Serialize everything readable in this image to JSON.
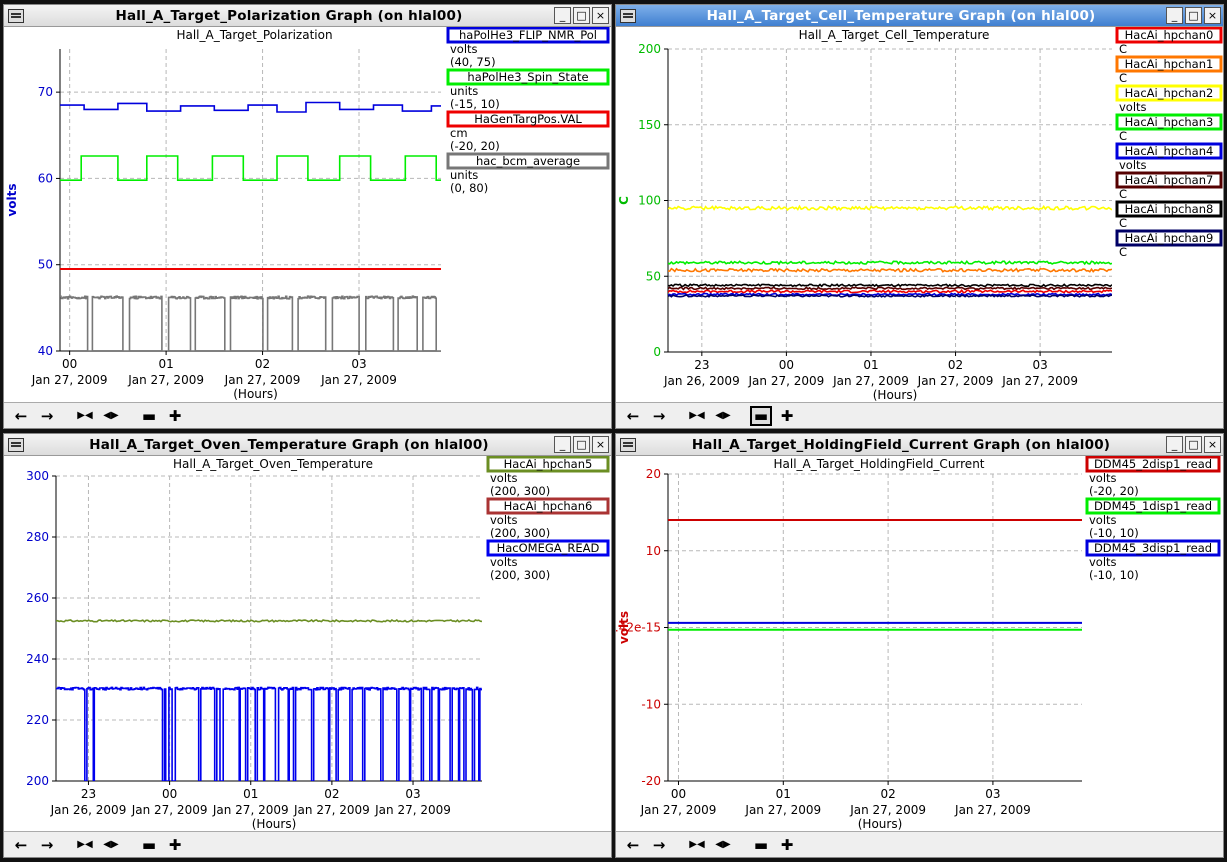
{
  "windows": [
    {
      "title": "Hall_A_Target_Polarization Graph (on hlal00)",
      "active": false,
      "chart_data": {
        "type": "line",
        "title": "Hall_A_Target_Polarization",
        "ylabel": "volts",
        "ylabel_color": "#0000cc",
        "xlabel": "(Hours)",
        "ylim": [
          40,
          75
        ],
        "xlim": [
          -0.1,
          3.85
        ],
        "yticks": [
          40,
          50,
          60,
          70
        ],
        "ytick_color": "#0000cc",
        "xticks": [
          {
            "x": 0,
            "label": "00",
            "date": "Jan 27, 2009"
          },
          {
            "x": 1,
            "label": "01",
            "date": "Jan 27, 2009"
          },
          {
            "x": 2,
            "label": "02",
            "date": "Jan 27, 2009"
          },
          {
            "x": 3,
            "label": "03",
            "date": "Jan 27, 2009"
          }
        ],
        "series": [
          {
            "name": "haPolHe3_FLIP_NMR_Pol",
            "color": "#0000dd",
            "unit": "volts",
            "range": "(40, 75)",
            "kind": "step",
            "points": [
              [
                -0.1,
                68.5
              ],
              [
                0.15,
                68.5
              ],
              [
                0.15,
                68.0
              ],
              [
                0.5,
                68.0
              ],
              [
                0.5,
                68.7
              ],
              [
                0.8,
                68.7
              ],
              [
                0.8,
                67.8
              ],
              [
                1.15,
                67.8
              ],
              [
                1.15,
                68.4
              ],
              [
                1.5,
                68.4
              ],
              [
                1.5,
                67.9
              ],
              [
                1.85,
                67.9
              ],
              [
                1.85,
                68.5
              ],
              [
                2.15,
                68.5
              ],
              [
                2.15,
                67.7
              ],
              [
                2.45,
                67.7
              ],
              [
                2.45,
                68.8
              ],
              [
                2.8,
                68.8
              ],
              [
                2.8,
                68.0
              ],
              [
                3.15,
                68.0
              ],
              [
                3.15,
                68.5
              ],
              [
                3.45,
                68.5
              ],
              [
                3.45,
                67.8
              ],
              [
                3.75,
                67.8
              ],
              [
                3.75,
                68.4
              ],
              [
                3.85,
                68.4
              ]
            ]
          },
          {
            "name": "haPolHe3_Spin_State",
            "color": "#00ee00",
            "unit": "units",
            "range": "(-15, 10)",
            "kind": "pulse",
            "base": 59.8,
            "high": 62.6,
            "pulses": [
              [
                0.12,
                0.5
              ],
              [
                0.8,
                1.12
              ],
              [
                1.48,
                1.8
              ],
              [
                2.15,
                2.47
              ],
              [
                2.8,
                3.12
              ],
              [
                3.48,
                3.8
              ]
            ]
          },
          {
            "name": "HaGenTargPos.VAL",
            "color": "#ee0000",
            "unit": "cm",
            "range": "(-20, 20)",
            "kind": "flat",
            "value": 49.5
          },
          {
            "name": "hac_bcm_average",
            "color": "#777777",
            "unit": "units",
            "range": "(0, 80)",
            "kind": "beam",
            "high": 46.2,
            "low": 40.0,
            "drops": [
              [
                0.18,
                0.23
              ],
              [
                0.55,
                0.62
              ],
              [
                0.95,
                1.02
              ],
              [
                1.25,
                1.3
              ],
              [
                1.6,
                1.66
              ],
              [
                2.0,
                2.05
              ],
              [
                2.3,
                2.36
              ],
              [
                2.65,
                2.72
              ],
              [
                3.0,
                3.06
              ],
              [
                3.35,
                3.4
              ],
              [
                3.6,
                3.66
              ],
              [
                3.8,
                3.85
              ]
            ]
          }
        ]
      }
    },
    {
      "title": "Hall_A_Target_Cell_Temperature Graph (on hlal00)",
      "active": true,
      "chart_data": {
        "type": "line",
        "title": "Hall_A_Target_Cell_Temperature",
        "ylabel": "C",
        "ylabel_color": "#00bb00",
        "xlabel": "(Hours)",
        "ylim": [
          0,
          200
        ],
        "xlim": [
          -1.4,
          3.85
        ],
        "yticks": [
          0,
          50,
          100,
          150,
          200
        ],
        "ytick_color": "#00bb00",
        "xticks": [
          {
            "x": -1,
            "label": "23",
            "date": "Jan 26, 2009"
          },
          {
            "x": 0,
            "label": "00",
            "date": "Jan 27, 2009"
          },
          {
            "x": 1,
            "label": "01",
            "date": "Jan 27, 2009"
          },
          {
            "x": 2,
            "label": "02",
            "date": "Jan 27, 2009"
          },
          {
            "x": 3,
            "label": "03",
            "date": "Jan 27, 2009"
          }
        ],
        "series": [
          {
            "name": "HacAi_hpchan0",
            "color": "#ee0000",
            "unit": "C",
            "kind": "noisy",
            "value": 40,
            "amp": 0.8
          },
          {
            "name": "HacAi_hpchan1",
            "color": "#ff7700",
            "unit": "C",
            "kind": "noisy",
            "value": 54,
            "amp": 1.0
          },
          {
            "name": "HacAi_hpchan2",
            "color": "#ffff00",
            "unit": "volts",
            "kind": "noisy",
            "value": 95,
            "amp": 1.2
          },
          {
            "name": "HacAi_hpchan3",
            "color": "#00ee00",
            "unit": "C",
            "kind": "noisy",
            "value": 59,
            "amp": 0.9
          },
          {
            "name": "HacAi_hpchan4",
            "color": "#0000dd",
            "unit": "volts",
            "kind": "noisy",
            "value": 38,
            "amp": 0.6
          },
          {
            "name": "HacAi_hpchan7",
            "color": "#550000",
            "unit": "C",
            "kind": "noisy",
            "value": 42,
            "amp": 0.7
          },
          {
            "name": "HacAi_hpchan8",
            "color": "#000000",
            "unit": "C",
            "kind": "noisy",
            "value": 44,
            "amp": 0.7
          },
          {
            "name": "HacAi_hpchan9",
            "color": "#000066",
            "unit": "C",
            "kind": "noisy",
            "value": 37,
            "amp": 0.6
          }
        ]
      }
    },
    {
      "title": "Hall_A_Target_Oven_Temperature Graph (on hlal00)",
      "active": false,
      "chart_data": {
        "type": "line",
        "title": "Hall_A_Target_Oven_Temperature",
        "ylabel": "",
        "ylabel_color": "#0000cc",
        "xlabel": "(Hours)",
        "ylim": [
          200,
          300
        ],
        "xlim": [
          -1.4,
          3.85
        ],
        "yticks": [
          200,
          220,
          240,
          260,
          280,
          300
        ],
        "ytick_color": "#0000cc",
        "xticks": [
          {
            "x": -1,
            "label": "23",
            "date": "Jan 26, 2009"
          },
          {
            "x": 0,
            "label": "00",
            "date": "Jan 27, 2009"
          },
          {
            "x": 1,
            "label": "01",
            "date": "Jan 27, 2009"
          },
          {
            "x": 2,
            "label": "02",
            "date": "Jan 27, 2009"
          },
          {
            "x": 3,
            "label": "03",
            "date": "Jan 27, 2009"
          }
        ],
        "series": [
          {
            "name": "HacAi_hpchan5",
            "color": "#6b8e23",
            "unit": "volts",
            "range": "(200, 300)",
            "kind": "noisy",
            "value": 252.5,
            "amp": 0.3
          },
          {
            "name": "HacAi_hpchan6",
            "color": "#aa3333",
            "unit": "volts",
            "range": "(200, 300)",
            "kind": "none"
          },
          {
            "name": "HacOMEGA_READ",
            "color": "#0000ee",
            "unit": "volts",
            "range": "(200, 300)",
            "kind": "beam",
            "high": 230.3,
            "low": 200.0,
            "noise": 0.4,
            "drops": [
              [
                -1.05,
                -1.03
              ],
              [
                -0.95,
                -0.93
              ],
              [
                -0.1,
                -0.07
              ],
              [
                -0.05,
                -0.02
              ],
              [
                0.03,
                0.06
              ],
              [
                0.35,
                0.38
              ],
              [
                0.55,
                0.58
              ],
              [
                0.62,
                0.65
              ],
              [
                0.85,
                0.87
              ],
              [
                0.93,
                0.95
              ],
              [
                1.05,
                1.07
              ],
              [
                1.15,
                1.17
              ],
              [
                1.3,
                1.33
              ],
              [
                1.45,
                1.47
              ],
              [
                1.52,
                1.54
              ],
              [
                1.75,
                1.77
              ],
              [
                1.95,
                1.97
              ],
              [
                2.05,
                2.07
              ],
              [
                2.22,
                2.24
              ],
              [
                2.38,
                2.4
              ],
              [
                2.6,
                2.62
              ],
              [
                2.8,
                2.82
              ],
              [
                2.95,
                2.97
              ],
              [
                3.1,
                3.12
              ],
              [
                3.2,
                3.22
              ],
              [
                3.3,
                3.32
              ],
              [
                3.45,
                3.47
              ],
              [
                3.55,
                3.57
              ],
              [
                3.62,
                3.64
              ],
              [
                3.73,
                3.75
              ],
              [
                3.8,
                3.82
              ]
            ]
          }
        ]
      }
    },
    {
      "title": "Hall_A_Target_HoldingField_Current Graph (on hlal00)",
      "active": false,
      "chart_data": {
        "type": "line",
        "title": "Hall_A_Target_HoldingField_Current",
        "ylabel": "volts",
        "ylabel_color": "#cc0000",
        "xlabel": "(Hours)",
        "ylim": [
          -20,
          20
        ],
        "xlim": [
          -0.1,
          3.85
        ],
        "yticks": [
          -20,
          -10,
          0,
          10,
          20
        ],
        "ytick_labels": [
          "-20",
          "-10",
          "1.42e-15",
          "10",
          "20"
        ],
        "ytick_color": "#cc0000",
        "xticks": [
          {
            "x": 0,
            "label": "00",
            "date": "Jan 27, 2009"
          },
          {
            "x": 1,
            "label": "01",
            "date": "Jan 27, 2009"
          },
          {
            "x": 2,
            "label": "02",
            "date": "Jan 27, 2009"
          },
          {
            "x": 3,
            "label": "03",
            "date": "Jan 27, 2009"
          }
        ],
        "series": [
          {
            "name": "DDM45_2disp1_read",
            "color": "#cc0000",
            "unit": "volts",
            "range": "(-20, 20)",
            "kind": "flat",
            "value": 14.0
          },
          {
            "name": "DDM45_1disp1_read",
            "color": "#00ee00",
            "unit": "volts",
            "range": "(-10, 10)",
            "kind": "flat",
            "value": -0.3
          },
          {
            "name": "DDM45_3disp1_read",
            "color": "#0000dd",
            "unit": "volts",
            "range": "(-10, 10)",
            "kind": "flat",
            "value": 0.6
          }
        ]
      }
    }
  ],
  "toolbar_icons": [
    "arrow-left-icon",
    "arrow-right-icon",
    "zoom-in-x-icon",
    "zoom-out-x-icon",
    "pan-icon",
    "add-icon"
  ],
  "titlebar_buttons": [
    "minimize",
    "maximize",
    "close"
  ]
}
